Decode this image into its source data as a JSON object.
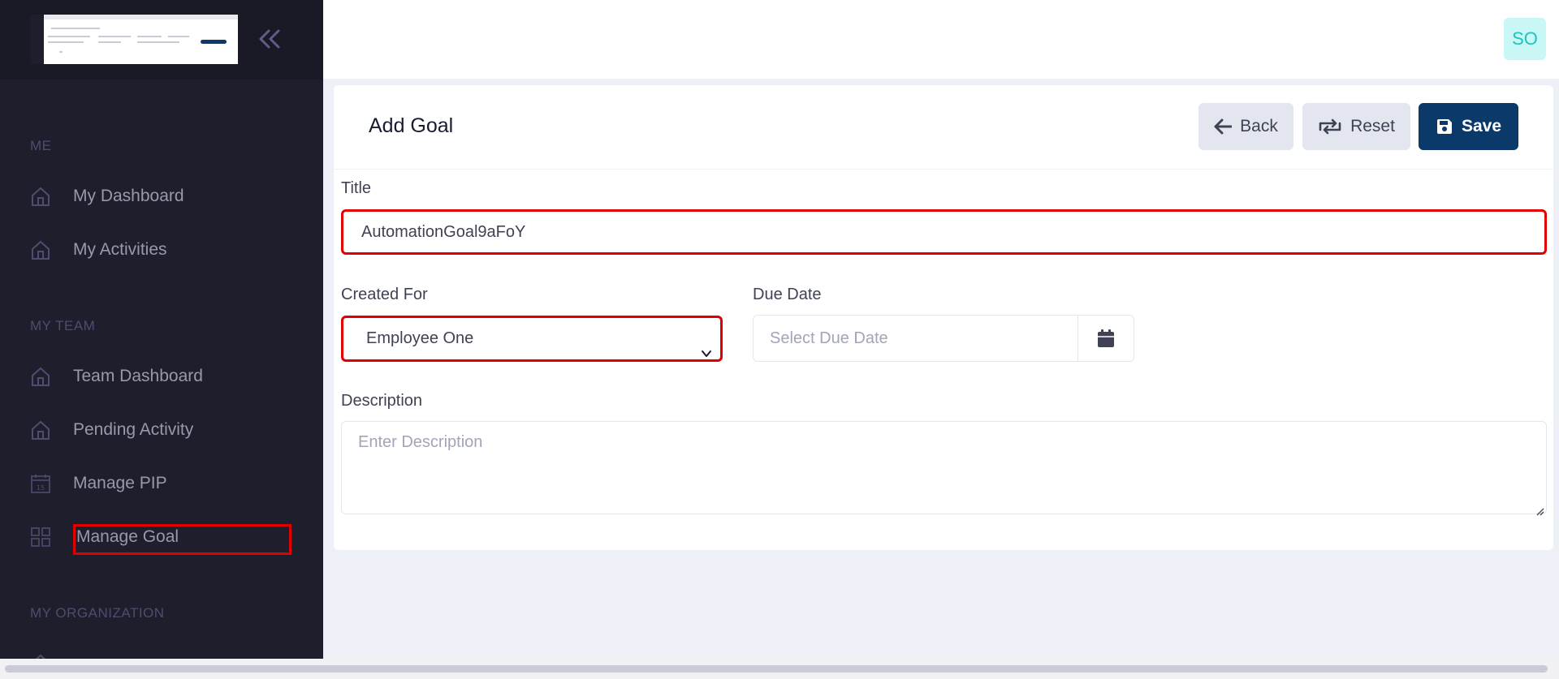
{
  "sidebar": {
    "collapse_icon": "double-chevron-left-icon",
    "sections": {
      "me": "ME",
      "my_team": "MY TEAM",
      "my_organization": "MY ORGANIZATION"
    },
    "items": [
      {
        "label": "My Dashboard",
        "icon": "home-icon"
      },
      {
        "label": "My Activities",
        "icon": "home-icon"
      },
      {
        "label": "Team Dashboard",
        "icon": "home-icon"
      },
      {
        "label": "Pending Activity",
        "icon": "home-icon"
      },
      {
        "label": "Manage PIP",
        "icon": "calendar-icon"
      },
      {
        "label": "Manage Goal",
        "icon": "grid-icon"
      }
    ],
    "active_item": "Manage Goal"
  },
  "header": {
    "avatar_initials": "SO"
  },
  "form": {
    "title": "Add Goal",
    "buttons": {
      "back": "Back",
      "reset": "Reset",
      "save": "Save"
    },
    "fields": {
      "title_label": "Title",
      "title_value": "AutomationGoal9aFoY",
      "created_for_label": "Created For",
      "created_for_value": "Employee One",
      "due_date_label": "Due Date",
      "due_date_placeholder": "Select Due Date",
      "description_label": "Description",
      "description_placeholder": "Enter Description"
    }
  },
  "colors": {
    "sidebar_bg": "#1e1e2d",
    "primary": "#0b3a6a",
    "highlight": "#e00000",
    "avatar_bg": "#c9f7f5",
    "avatar_text": "#1bc5bd"
  }
}
